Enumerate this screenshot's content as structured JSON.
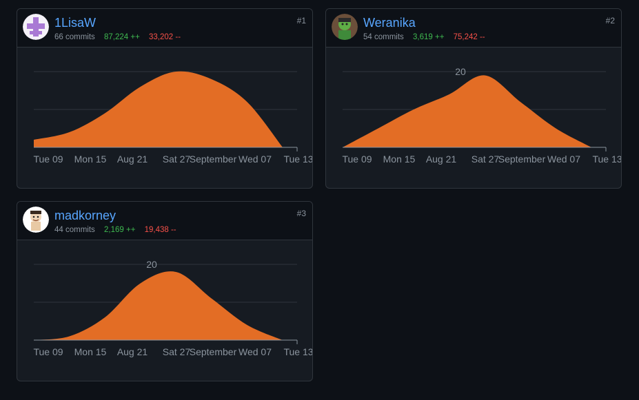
{
  "contributors": [
    {
      "rank": "#1",
      "username": "1LisaW",
      "commits": "66 commits",
      "additions": "87,224 ++",
      "deletions": "33,202 --",
      "avatar": "purple-cross-identicon",
      "y_tick_label": "",
      "x_ticks": [
        "Tue 09",
        "Mon 15",
        "Aug 21",
        "Sat 27",
        "September",
        "Wed 07",
        "Tue 13"
      ]
    },
    {
      "rank": "#2",
      "username": "Weranika",
      "commits": "54 commits",
      "additions": "3,619 ++",
      "deletions": "75,242 --",
      "avatar": "green-hulk-avatar",
      "y_tick_label": "20",
      "x_ticks": [
        "Tue 09",
        "Mon 15",
        "Aug 21",
        "Sat 27",
        "September",
        "Wed 07",
        "Tue 13"
      ]
    },
    {
      "rank": "#3",
      "username": "madkorney",
      "commits": "44 commits",
      "additions": "2,169 ++",
      "deletions": "19,438 --",
      "avatar": "cartoon-character-avatar",
      "y_tick_label": "20",
      "x_ticks": [
        "Tue 09",
        "Mon 15",
        "Aug 21",
        "Sat 27",
        "September",
        "Wed 07",
        "Tue 13"
      ]
    }
  ],
  "chart_data": [
    {
      "type": "area",
      "title": "1LisaW",
      "x_tick_labels": [
        "Tue 09",
        "Mon 15",
        "Aug 21",
        "Sat 27",
        "September",
        "Wed 07",
        "Tue 13"
      ],
      "ylim": [
        0,
        20
      ],
      "grid": true,
      "color": "#e36d25",
      "series": [
        {
          "values": [
            2,
            4,
            9,
            16,
            20,
            18,
            12,
            0
          ]
        }
      ]
    },
    {
      "type": "area",
      "title": "Weranika",
      "x_tick_labels": [
        "Tue 09",
        "Mon 15",
        "Aug 21",
        "Sat 27",
        "September",
        "Wed 07",
        "Tue 13"
      ],
      "ylim": [
        0,
        20
      ],
      "grid": true,
      "color": "#e36d25",
      "series": [
        {
          "values": [
            0,
            5,
            10,
            14,
            19,
            12,
            5,
            0
          ]
        }
      ]
    },
    {
      "type": "area",
      "title": "madkorney",
      "x_tick_labels": [
        "Tue 09",
        "Mon 15",
        "Aug 21",
        "Sat 27",
        "September",
        "Wed 07",
        "Tue 13"
      ],
      "ylim": [
        0,
        20
      ],
      "grid": true,
      "color": "#e36d25",
      "series": [
        {
          "values": [
            0,
            1,
            6,
            15,
            18,
            11,
            4,
            0
          ]
        }
      ]
    }
  ]
}
